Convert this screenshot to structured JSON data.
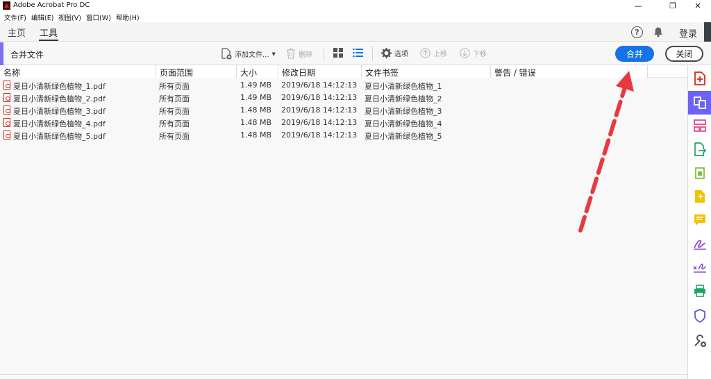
{
  "window": {
    "title": "Adobe Acrobat Pro DC",
    "controls": {
      "minimize": "—",
      "restore": "❐",
      "close": "✕"
    }
  },
  "menu": [
    "文件(F)",
    "编辑(E)",
    "视图(V)",
    "窗口(W)",
    "帮助(H)"
  ],
  "tabs": {
    "home": "主页",
    "tools": "工具",
    "active": "工具"
  },
  "header_right": {
    "help": "?",
    "login": "登录"
  },
  "toolbar": {
    "title": "合并文件",
    "add_files": "添加文件...",
    "delete": "删除",
    "options": "选项",
    "move_up": "上移",
    "move_down": "下移",
    "combine": "合并",
    "close": "关闭"
  },
  "table": {
    "columns": [
      "名称",
      "页面范围",
      "大小",
      "修改日期",
      "文件书签",
      "警告 / 错误"
    ],
    "rows": [
      {
        "name": "夏日小清新绿色植物_1.pdf",
        "range": "所有页面",
        "size": "1.49 MB",
        "date": "2019/6/18 14:12:13",
        "bookmark": "夏日小清新绿色植物_1",
        "warning": ""
      },
      {
        "name": "夏日小清新绿色植物_2.pdf",
        "range": "所有页面",
        "size": "1.49 MB",
        "date": "2019/6/18 14:12:13",
        "bookmark": "夏日小清新绿色植物_2",
        "warning": ""
      },
      {
        "name": "夏日小清新绿色植物_3.pdf",
        "range": "所有页面",
        "size": "1.48 MB",
        "date": "2019/6/18 14:12:13",
        "bookmark": "夏日小清新绿色植物_3",
        "warning": ""
      },
      {
        "name": "夏日小清新绿色植物_4.pdf",
        "range": "所有页面",
        "size": "1.48 MB",
        "date": "2019/6/18 14:12:13",
        "bookmark": "夏日小清新绿色植物_4",
        "warning": ""
      },
      {
        "name": "夏日小清新绿色植物_5.pdf",
        "range": "所有页面",
        "size": "1.48 MB",
        "date": "2019/6/18 14:12:13",
        "bookmark": "夏日小清新绿色植物_5",
        "warning": ""
      }
    ]
  },
  "right_panel_icons": [
    "create-pdf-icon",
    "combine-files-icon",
    "organize-pages-icon",
    "export-pdf-icon",
    "edit-pdf-icon",
    "create-form-icon",
    "comment-icon",
    "fill-sign-icon",
    "send-for-signature-icon",
    "print-production-icon",
    "protect-icon",
    "more-tools-icon"
  ],
  "colors": {
    "accent": "#1473e6",
    "tool_accent": "#7a6ff0",
    "arrow": "#e8393f"
  }
}
